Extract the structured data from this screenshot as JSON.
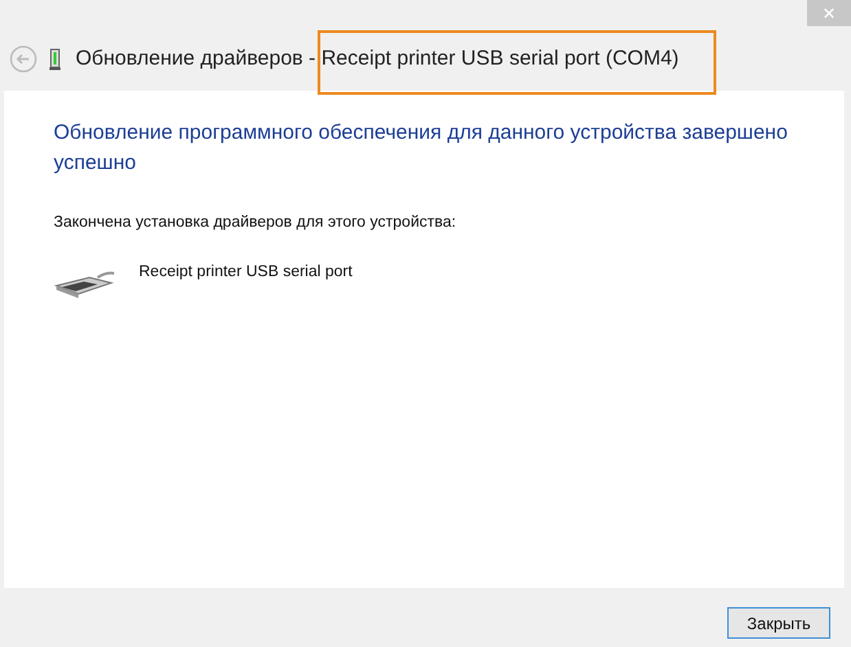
{
  "window": {
    "close_glyph": "✕",
    "title": "Обновление драйверов - Receipt printer USB serial port (COM4)"
  },
  "content": {
    "heading": "Обновление программного обеспечения для данного устройства завершено успешно",
    "message": "Закончена установка драйверов для этого устройства:",
    "device_name": "Receipt printer USB serial port"
  },
  "buttons": [
    "Закрыть"
  ]
}
